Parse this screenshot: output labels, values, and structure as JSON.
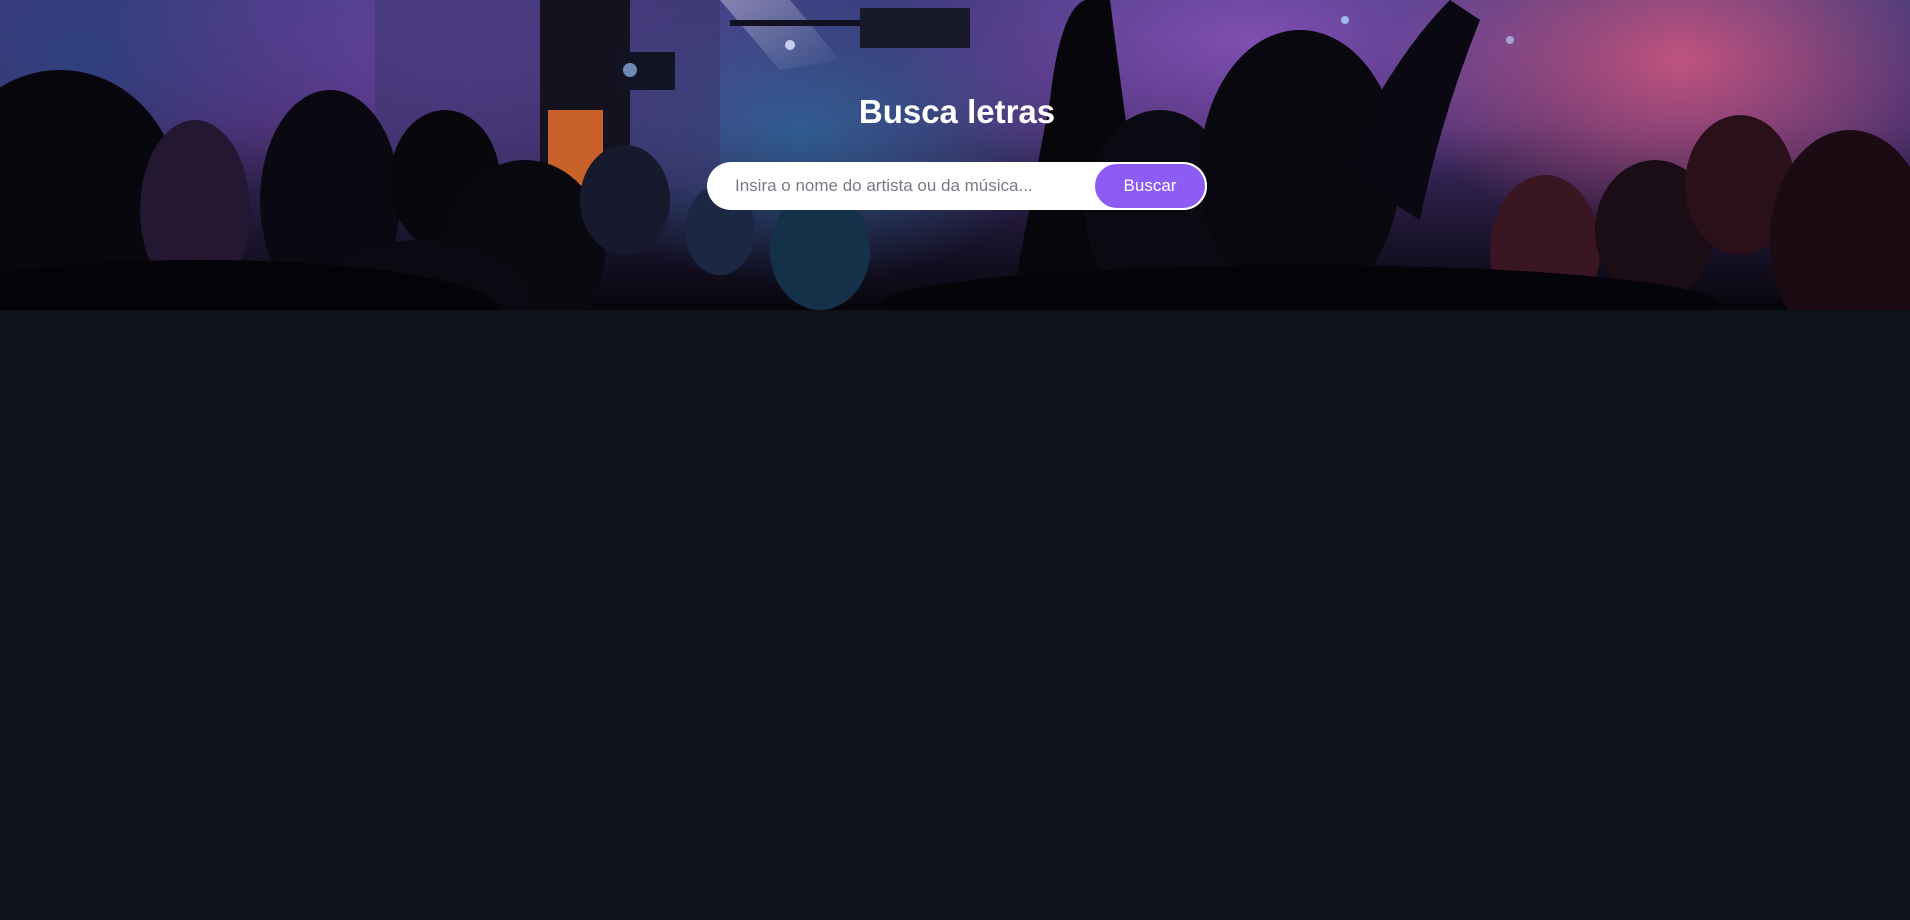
{
  "header": {
    "title": "Busca letras",
    "background_image": "concert-crowd-photo"
  },
  "search": {
    "placeholder": "Insira o nome do artista ou da música...",
    "value": "",
    "button_label": "Buscar"
  },
  "colors": {
    "page_background": "#0e131a",
    "accent": "#8c5cf4",
    "title": "#ffffff",
    "input_background": "#ffffff"
  }
}
